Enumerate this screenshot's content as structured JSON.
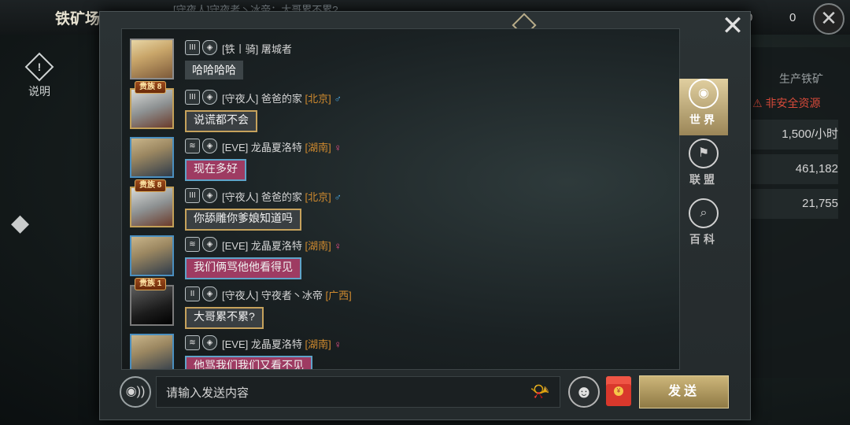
{
  "background": {
    "title": "铁矿场",
    "ticker": "[守夜人]守夜者丶冰帝：大哥累不累?",
    "resources": [
      "0",
      "0"
    ],
    "info_label": "说明",
    "panel_header": "生产铁矿",
    "panel_warning": "⚠ 非安全资源",
    "panel_rows": [
      "1,500/小时",
      "461,182",
      "21,755"
    ]
  },
  "messages": [
    {
      "noble": "",
      "alliance": "[铁丨骑]",
      "name": "屠城者",
      "location": "",
      "gender": "",
      "text": "哈哈哈哈",
      "avatar": "blonde",
      "bubble": "plain",
      "rank": "III"
    },
    {
      "noble": "贵族 8",
      "alliance": "[守夜人]",
      "name": "爸爸的家",
      "location": "[北京]",
      "gender": "♂",
      "text": "说谎都不会",
      "avatar": "gold",
      "bubble": "gold",
      "rank": "III"
    },
    {
      "noble": "",
      "alliance": "[EVE]",
      "name": "龙晶夏洛特",
      "location": "[湖南]",
      "gender": "♀",
      "text": "现在多好",
      "avatar": "blue",
      "bubble": "pink",
      "rank": "≋"
    },
    {
      "noble": "贵族 8",
      "alliance": "[守夜人]",
      "name": "爸爸的家",
      "location": "[北京]",
      "gender": "♂",
      "text": "你舔雕你爹娘知道吗",
      "avatar": "gold",
      "bubble": "gold",
      "rank": "III"
    },
    {
      "noble": "",
      "alliance": "[EVE]",
      "name": "龙晶夏洛特",
      "location": "[湖南]",
      "gender": "♀",
      "text": "我们俩骂他他看得见",
      "avatar": "blue",
      "bubble": "pink",
      "rank": "≋"
    },
    {
      "noble": "贵族 1",
      "alliance": "[守夜人]",
      "name": "守夜者丶冰帝",
      "location": "[广西]",
      "gender": "",
      "text": "大哥累不累?",
      "avatar": "dark",
      "bubble": "gold",
      "rank": "II"
    },
    {
      "noble": "",
      "alliance": "[EVE]",
      "name": "龙晶夏洛特",
      "location": "[湖南]",
      "gender": "♀",
      "text": "他骂我们我们又看不见",
      "avatar": "blue",
      "bubble": "pink",
      "rank": "≋"
    }
  ],
  "tabs": [
    {
      "label": "世界",
      "active": true
    },
    {
      "label": "联盟",
      "active": false
    },
    {
      "label": "百科",
      "active": false
    }
  ],
  "input": {
    "placeholder": "请输入发送内容",
    "value": ""
  },
  "send_label": "发送",
  "icons": {
    "close": "close-icon",
    "voice": "voice-icon",
    "emoji": "emoji-icon",
    "horn": "horn-icon",
    "red_packet": "red-packet-icon"
  }
}
